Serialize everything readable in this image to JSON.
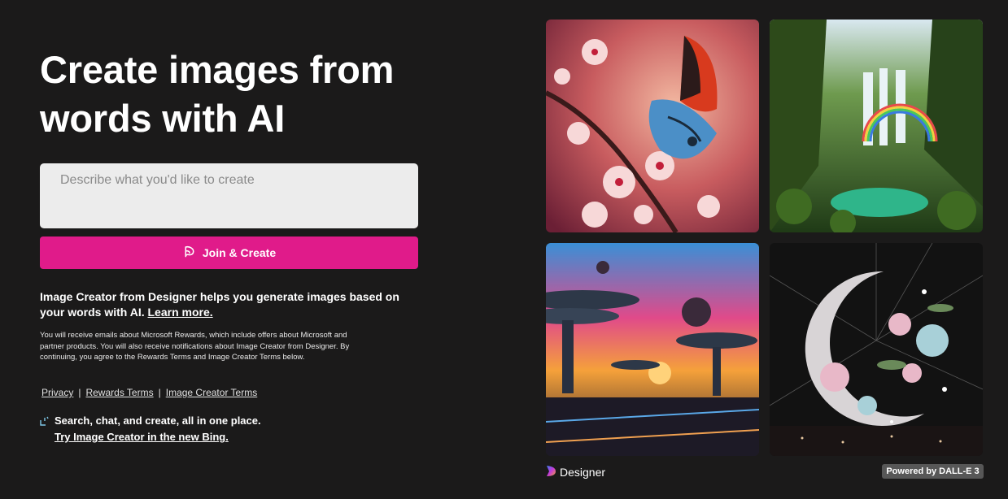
{
  "hero": {
    "headline": "Create images from\nwords with AI"
  },
  "prompt": {
    "placeholder": "Describe what you'd like to create",
    "value": ""
  },
  "join_button": {
    "label": "Join & Create",
    "icon": "designer-swirl-icon",
    "color": "#e01b8a"
  },
  "description": {
    "text": "Image Creator from Designer helps you generate images based on your words with AI. ",
    "learn_more": "Learn more."
  },
  "fine_print": "You will receive emails about Microsoft Rewards, which include offers about Microsoft and partner products. You will also receive notifications about Image Creator from Designer. By continuing, you agree to the Rewards Terms and Image Creator Terms below.",
  "footer_links": {
    "privacy": "Privacy",
    "separator": "|",
    "rewards_terms": "Rewards Terms",
    "image_creator_terms": "Image Creator Terms"
  },
  "promo": {
    "icon": "bing-sparkle-icon",
    "text": "Search, chat, and create, all in one place.",
    "link": "Try Image Creator in the new Bing."
  },
  "gallery": [
    {
      "subject": "butterfly-cherry-blossom-image"
    },
    {
      "subject": "waterfall-rainbow-jungle-image"
    },
    {
      "subject": "futuristic-city-sunset-image"
    },
    {
      "subject": "floral-crescent-moon-image"
    }
  ],
  "branding": {
    "designer_label": "Designer",
    "dalle_badge": "Powered by DALL-E 3"
  },
  "colors": {
    "background": "#1b1a1a",
    "accent": "#e01b8a",
    "input_bg": "#ececec",
    "badge_bg": "#575757"
  }
}
